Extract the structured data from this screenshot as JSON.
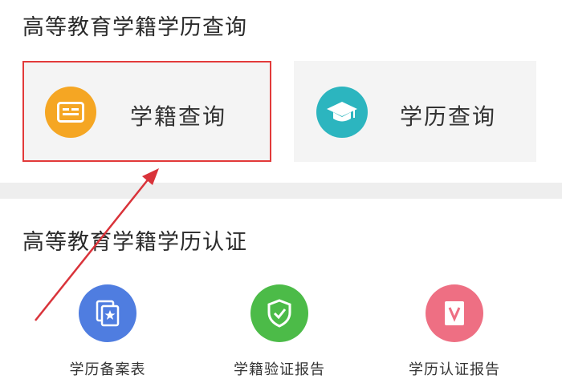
{
  "colors": {
    "highlight_border": "#e23a3a",
    "annotation_arrow": "#d9333a",
    "xueji_icon": "#f5a623",
    "xueli_icon": "#2cb5bf",
    "beian_icon": "#4f7de0",
    "yanzheng_icon": "#4cbb48",
    "renzheng_icon": "#ee6f83"
  },
  "query_section": {
    "title": "高等教育学籍学历查询",
    "cards": [
      {
        "label": "学籍查询",
        "icon": "id-card-icon"
      },
      {
        "label": "学历查询",
        "icon": "graduation-cap-icon"
      }
    ]
  },
  "verify_section": {
    "title": "高等教育学籍学历认证",
    "items": [
      {
        "label": "学历备案表",
        "icon": "record-form-icon"
      },
      {
        "label": "学籍验证报告",
        "icon": "shield-check-icon"
      },
      {
        "label": "学历认证报告",
        "icon": "v-document-icon"
      }
    ]
  }
}
